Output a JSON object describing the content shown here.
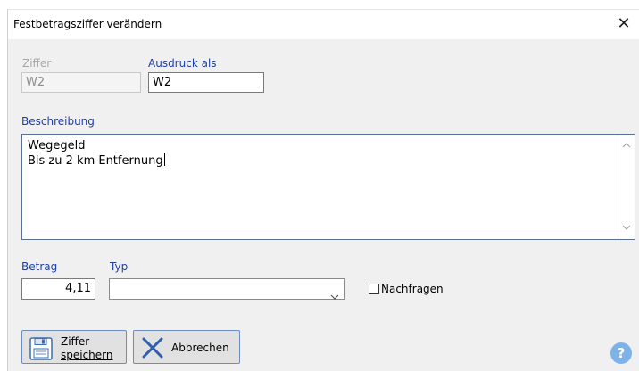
{
  "window": {
    "title": "Festbetragsziffer verändern",
    "close_glyph": "✕"
  },
  "ziffer": {
    "label": "Ziffer",
    "value": "W2"
  },
  "ausdruck": {
    "label": "Ausdruck als",
    "value": "W2"
  },
  "beschreibung": {
    "label": "Beschreibung",
    "lines": [
      "Wegegeld",
      "Bis zu 2 km Entfernung"
    ]
  },
  "betrag": {
    "label": "Betrag",
    "value": "4,11"
  },
  "typ": {
    "label": "Typ",
    "value": ""
  },
  "nachfragen": {
    "label": "Nachfragen",
    "checked": false
  },
  "buttons": {
    "save_line1": "Ziffer",
    "save_line2": "speichern",
    "cancel": "Abbrechen"
  },
  "help": {
    "glyph": "?"
  },
  "colors": {
    "label_blue": "#1f3fa8",
    "help_blue": "#7eb3ea",
    "cancel_x": "#2f5fae"
  },
  "icons": [
    "floppy-disk-icon",
    "cancel-x-icon",
    "help-icon",
    "chevron-down-icon",
    "scroll-up-icon",
    "scroll-down-icon",
    "close-icon"
  ]
}
